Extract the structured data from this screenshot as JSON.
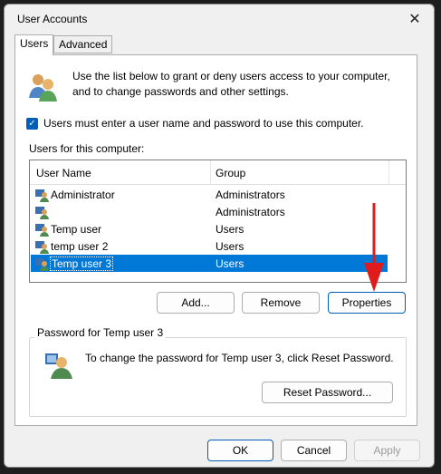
{
  "window": {
    "title": "User Accounts"
  },
  "tabs": [
    {
      "label": "Users",
      "active": true
    },
    {
      "label": "Advanced",
      "active": false
    }
  ],
  "intro": {
    "text": "Use the list below to grant or deny users access to your computer, and to change passwords and other settings."
  },
  "require_login": {
    "label": "Users must enter a user name and password to use this computer.",
    "checked": true
  },
  "users_list": {
    "label": "Users for this computer:",
    "columns": [
      "User Name",
      "Group"
    ],
    "rows": [
      {
        "name": "Administrator",
        "group": "Administrators"
      },
      {
        "name": "",
        "group": "Administrators"
      },
      {
        "name": "Temp user",
        "group": "Users"
      },
      {
        "name": "temp user 2",
        "group": "Users"
      },
      {
        "name": "Temp user 3",
        "group": "Users",
        "selected": true
      }
    ]
  },
  "list_buttons": {
    "add": "Add...",
    "remove": "Remove",
    "properties": "Properties"
  },
  "password_group": {
    "title": "Password for Temp user 3",
    "text": "To change the password for Temp user 3, click Reset Password.",
    "reset_button": "Reset Password..."
  },
  "dialog_buttons": {
    "ok": "OK",
    "cancel": "Cancel",
    "apply": "Apply"
  },
  "colors": {
    "accent": "#005fb8",
    "selection": "#0078d7",
    "annotation_arrow": "#e01b1b"
  },
  "icons": {
    "close": "close-icon",
    "users": "users-icon",
    "user": "user-icon",
    "key": "password-icon"
  }
}
